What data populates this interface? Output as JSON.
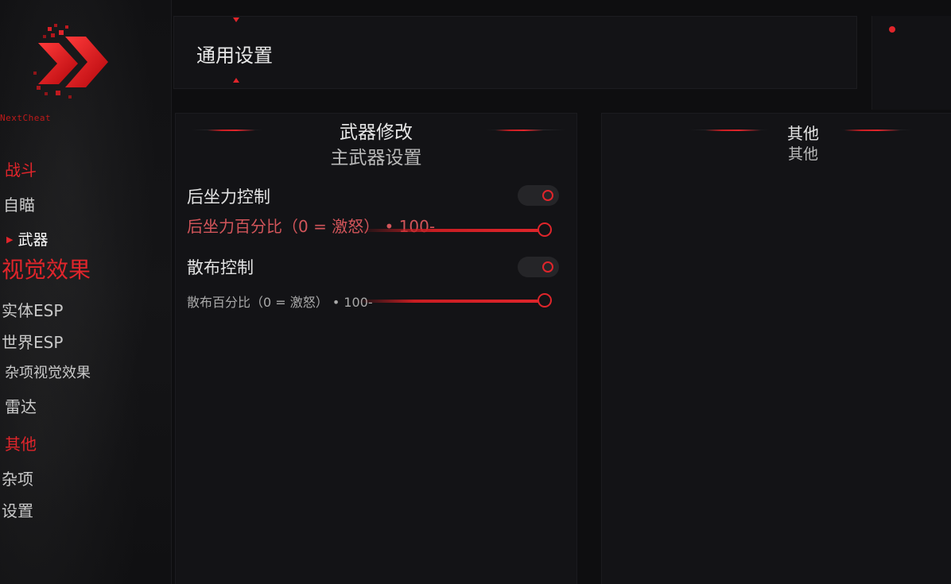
{
  "sidebar": {
    "brand": "NextCheat",
    "nav": [
      {
        "label": "战斗",
        "kind": "section"
      },
      {
        "label": "自瞄",
        "kind": "sub"
      },
      {
        "label": "武器",
        "kind": "active"
      },
      {
        "label": "视觉效果",
        "kind": "section-lg"
      },
      {
        "label": "实体ESP",
        "kind": "sub"
      },
      {
        "label": "世界ESP",
        "kind": "sub"
      },
      {
        "label": "杂项视觉效果",
        "kind": "sub-sm"
      },
      {
        "label": "雷达",
        "kind": "sub"
      },
      {
        "label": "其他",
        "kind": "section"
      },
      {
        "label": "杂项",
        "kind": "sub"
      },
      {
        "label": "设置",
        "kind": "sub"
      }
    ]
  },
  "header": {
    "title": "通用设置"
  },
  "left_panel": {
    "title": "武器修改",
    "subtitle": "主武器设置",
    "recoil_toggle": {
      "label": "后坐力控制",
      "on": true
    },
    "recoil_slider": {
      "label": "后坐力百分比（0 = 激怒） • 100-",
      "value": 100,
      "max": 100
    },
    "spread_toggle": {
      "label": "散布控制",
      "on": true
    },
    "spread_slider": {
      "label": "散布百分比（0 = 激怒） • 100-",
      "value": 100,
      "max": 100
    }
  },
  "right_panel": {
    "title": "其他",
    "subtitle": "其他"
  },
  "colors": {
    "accent": "#e0252b",
    "background": "#0e0e10",
    "panel": "#131316",
    "text": "#d6d6d6"
  }
}
